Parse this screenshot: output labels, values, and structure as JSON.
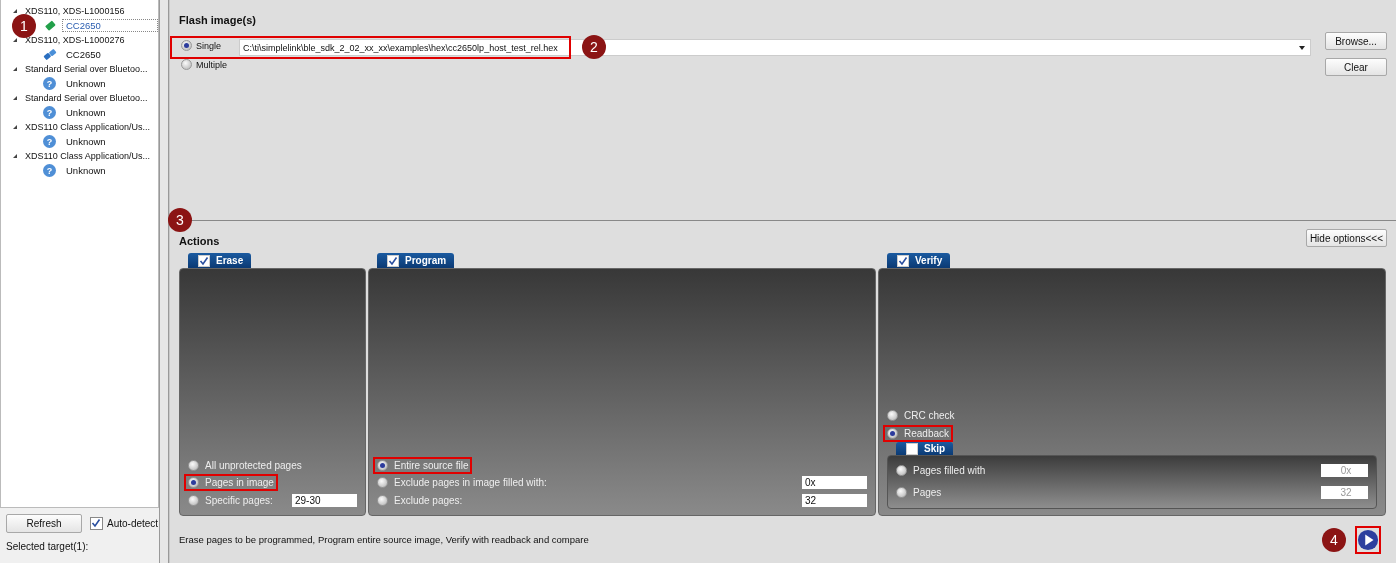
{
  "tree": {
    "items": [
      {
        "label": "XDS110, XDS-L1000156",
        "expanded": true,
        "children": [
          {
            "label": "CC2650",
            "kind": "chip-green",
            "selected": true,
            "callout": "1"
          }
        ]
      },
      {
        "label": "XDS110, XDS-L1000276",
        "expanded": true,
        "children": [
          {
            "label": "CC2650",
            "kind": "chip-blue",
            "selected": false
          }
        ]
      },
      {
        "label": "Standard Serial over Bluetoo...",
        "expanded": true,
        "children": [
          {
            "label": "Unknown",
            "kind": "unknown",
            "glyph": "?",
            "selected": false
          }
        ]
      },
      {
        "label": "Standard Serial over Bluetoo...",
        "expanded": true,
        "children": [
          {
            "label": "Unknown",
            "kind": "unknown",
            "glyph": "?",
            "selected": false
          }
        ]
      },
      {
        "label": "XDS110 Class Application/Us...",
        "expanded": true,
        "children": [
          {
            "label": "Unknown",
            "kind": "unknown",
            "glyph": "?",
            "selected": false
          }
        ]
      },
      {
        "label": "XDS110 Class Application/Us...",
        "expanded": true,
        "children": [
          {
            "label": "Unknown",
            "kind": "unknown",
            "glyph": "?",
            "selected": false
          }
        ]
      }
    ]
  },
  "refresh_button": "Refresh",
  "auto_detect": {
    "label": "Auto-detect",
    "checked": true
  },
  "selected_target": "Selected target(1):",
  "flash": {
    "title": "Flash image(s)",
    "modes": [
      {
        "label": "Single",
        "selected": true
      },
      {
        "label": "Multiple",
        "selected": false
      }
    ],
    "path": {
      "value": "C:\\ti\\simplelink\\ble_sdk_2_02_xx_xx\\examples\\hex\\cc2650lp_host_test_rel.hex",
      "highlighted": true,
      "callout": "2"
    },
    "buttons": [
      "Browse...",
      "Clear"
    ]
  },
  "actions": {
    "title": "Actions",
    "callout": "3",
    "hide_button": "Hide options<<<",
    "panels": [
      {
        "title": "Erase",
        "checked": true,
        "options": [
          {
            "label": "All unprotected pages",
            "selected": false
          },
          {
            "label": "Pages in image",
            "selected": true,
            "highlighted": true
          },
          {
            "label": "Specific pages:",
            "selected": false,
            "value": "29-30"
          }
        ]
      },
      {
        "title": "Program",
        "checked": true,
        "options": [
          {
            "label": "Entire source file",
            "selected": true,
            "highlighted": true
          },
          {
            "label": "Exclude pages in image filled with:",
            "selected": false,
            "value": "0x"
          },
          {
            "label": "Exclude pages:",
            "selected": false,
            "value": "32"
          }
        ]
      },
      {
        "title": "Verify",
        "checked": true,
        "options": [
          {
            "label": "CRC check",
            "selected": false
          },
          {
            "label": "Readback",
            "selected": true,
            "highlighted": true
          }
        ],
        "sub": {
          "title": "Skip",
          "checked": false,
          "options": [
            {
              "label": "Pages filled with",
              "selected": false,
              "value": "0x",
              "disabled": true
            },
            {
              "label": "Pages",
              "selected": false,
              "value": "32",
              "disabled": true
            }
          ]
        }
      }
    ]
  },
  "status": "Erase pages to be programmed, Program entire source image, Verify with readback and compare",
  "run_button": {
    "highlighted": true,
    "callout": "4"
  }
}
